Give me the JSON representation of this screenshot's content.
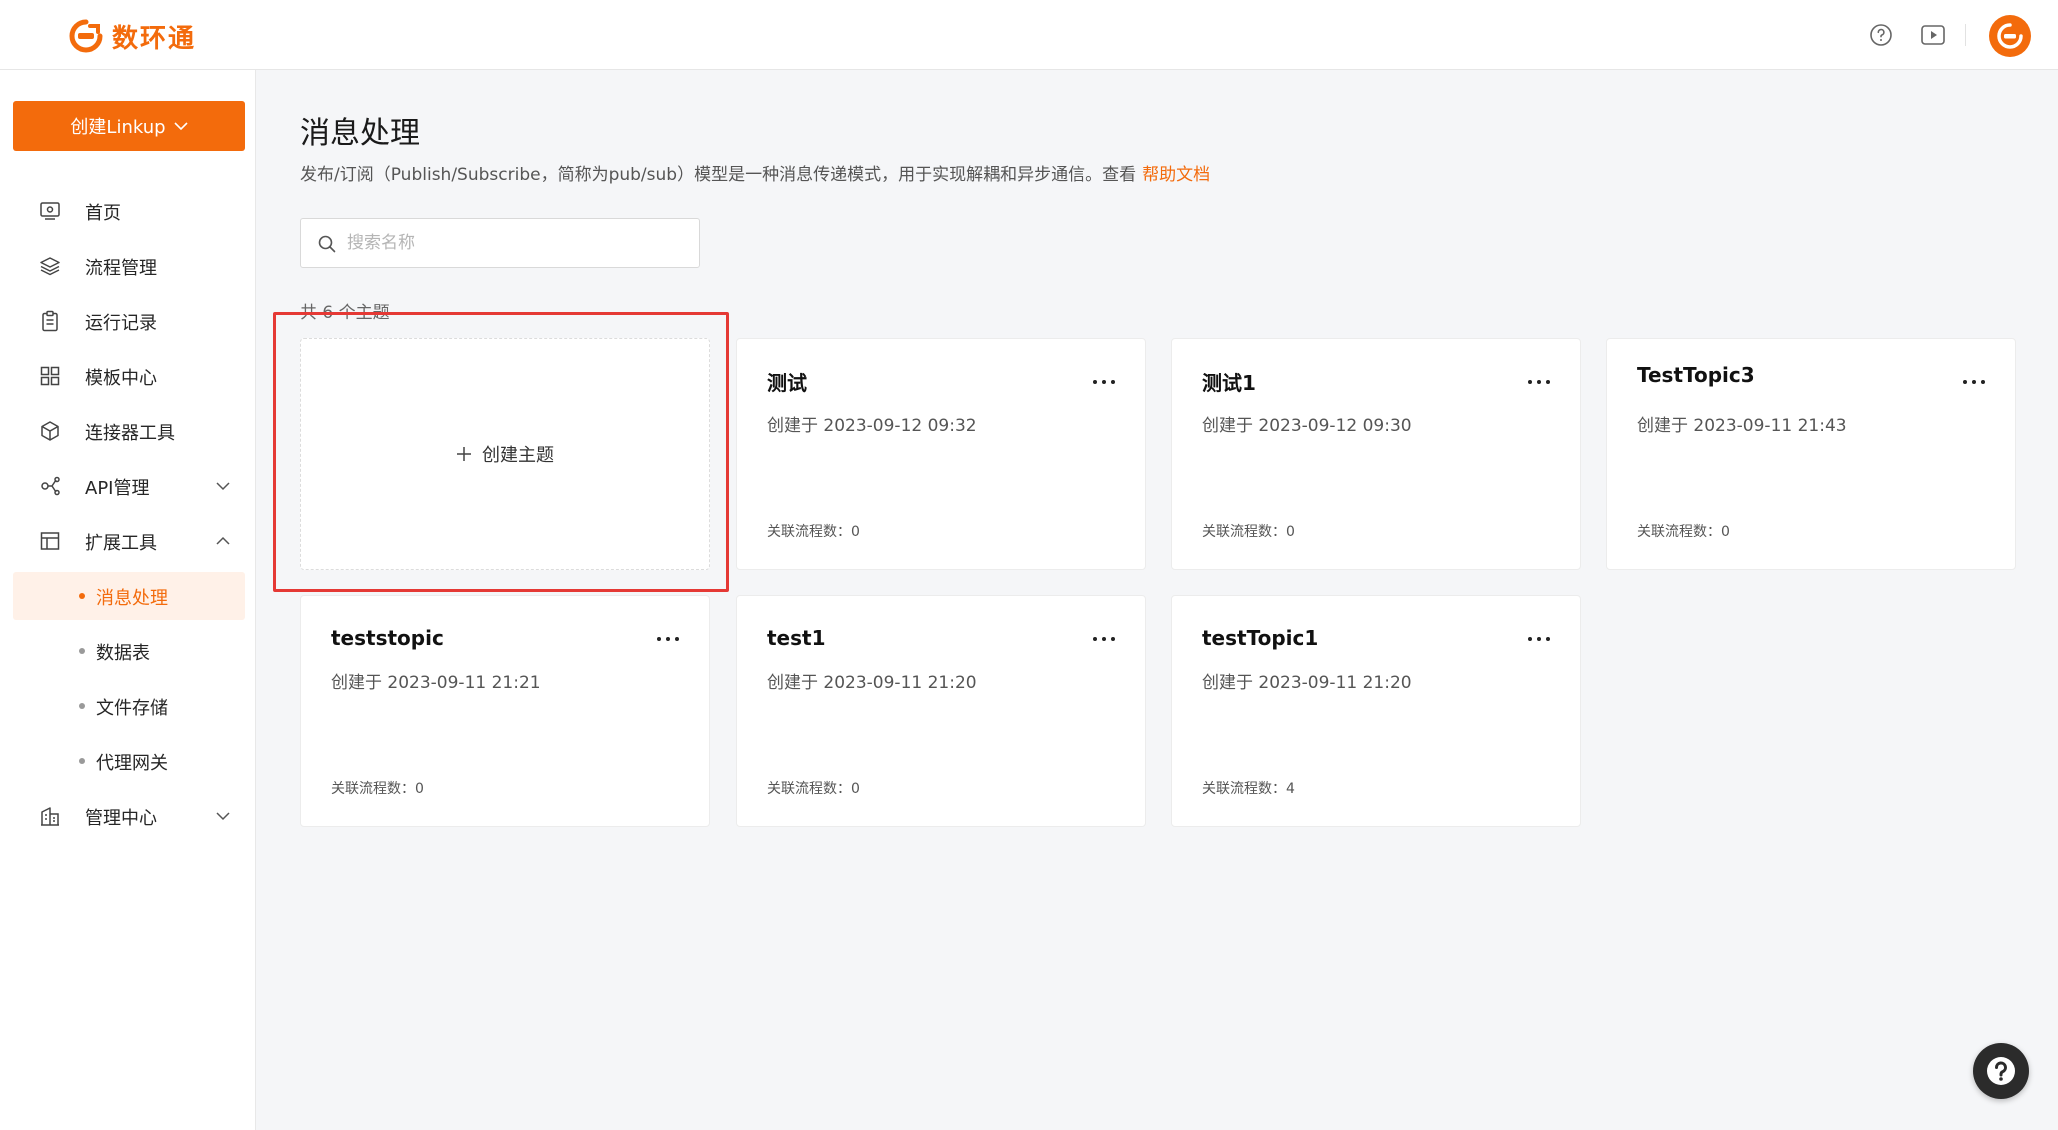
{
  "header": {
    "logo_text": "数环通",
    "icons": [
      "help-circle-icon",
      "video-play-icon"
    ],
    "brand_color": "#f36b0c"
  },
  "sidebar": {
    "create_button_label": "创建Linkup",
    "items": [
      {
        "label": "首页",
        "icon": "monitor-icon"
      },
      {
        "label": "流程管理",
        "icon": "layers-icon"
      },
      {
        "label": "运行记录",
        "icon": "clipboard-icon"
      },
      {
        "label": "模板中心",
        "icon": "grid-icon"
      },
      {
        "label": "连接器工具",
        "icon": "cube-icon"
      },
      {
        "label": "API管理",
        "icon": "api-icon",
        "expandable": true
      },
      {
        "label": "扩展工具",
        "icon": "layout-icon",
        "expanded": true
      }
    ],
    "sub_items": [
      {
        "label": "消息处理",
        "active": true
      },
      {
        "label": "数据表"
      },
      {
        "label": "文件存储"
      },
      {
        "label": "代理网关"
      }
    ],
    "bottom_item": {
      "label": "管理中心",
      "icon": "building-icon"
    }
  },
  "main": {
    "title": "消息处理",
    "description": "发布/订阅（Publish/Subscribe，简称为pub/sub）模型是一种消息传递模式，用于实现解耦和异步通信。查看",
    "help_link": "帮助文档",
    "search_placeholder": "搜索名称",
    "count_text": "共 6 个主题",
    "create_card_label": "创建主题",
    "topics": [
      {
        "name": "测试",
        "created": "创建于 2023-09-12 09:32",
        "flows": "关联流程数：0"
      },
      {
        "name": "测试1",
        "created": "创建于 2023-09-12 09:30",
        "flows": "关联流程数：0"
      },
      {
        "name": "TestTopic3",
        "created": "创建于 2023-09-11 21:43",
        "flows": "关联流程数：0"
      },
      {
        "name": "teststopic",
        "created": "创建于 2023-09-11 21:21",
        "flows": "关联流程数：0"
      },
      {
        "name": "test1",
        "created": "创建于 2023-09-11 21:20",
        "flows": "关联流程数：0"
      },
      {
        "name": "testTopic1",
        "created": "创建于 2023-09-11 21:20",
        "flows": "关联流程数：4"
      }
    ]
  }
}
